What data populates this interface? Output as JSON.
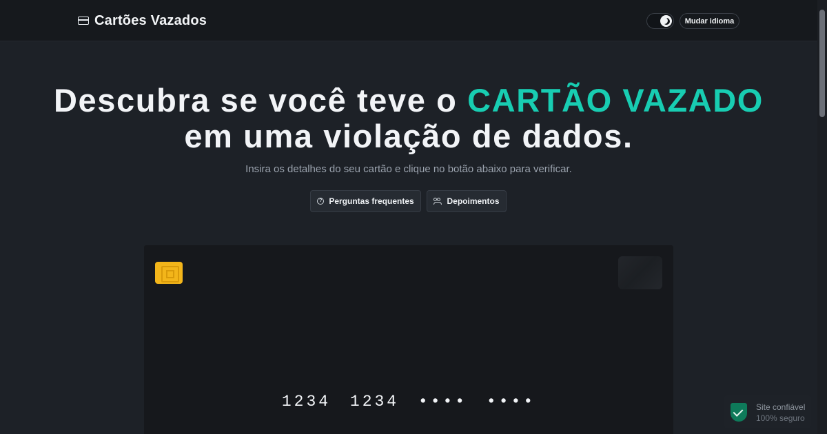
{
  "header": {
    "brand_icon": "credit-card-icon",
    "title": "Cartões Vazados",
    "theme_toggle_icon": "moon-icon",
    "language_button": "Mudar idioma"
  },
  "hero": {
    "title_part1": "Descubra se você teve o ",
    "title_accent": "CARTÃO VAZADO",
    "title_part2": " em uma violação de dados.",
    "subtitle": "Insira os detalhes do seu cartão e clique no botão abaixo para verificar.",
    "faq_button": "Perguntas frequentes",
    "faq_icon": "question-circle-icon",
    "testimonials_button": "Depoimentos",
    "testimonials_icon": "users-icon"
  },
  "card": {
    "chip_icon": "card-chip-icon",
    "number": "1234 1234 •••• ••••"
  },
  "trust_badge": {
    "icon": "shield-check-icon",
    "title": "Site confiável",
    "subtitle": "100% seguro"
  },
  "colors": {
    "accent": "#18cdb2",
    "background": "#1d2127",
    "chip": "#f3b51a",
    "shield": "#0e7a5a"
  }
}
